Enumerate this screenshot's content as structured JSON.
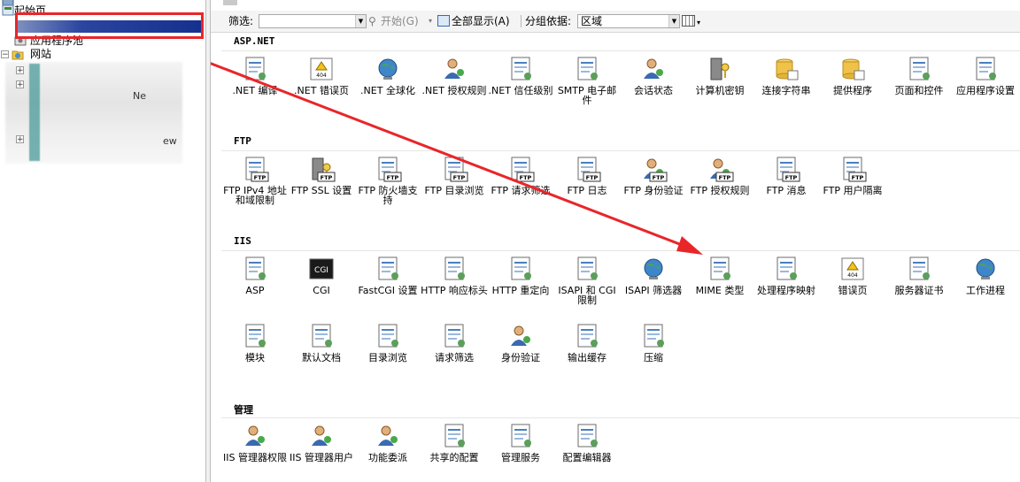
{
  "tree": {
    "items": [
      {
        "label": "起始页"
      },
      {
        "label": "应用程序池"
      },
      {
        "label": "网站"
      },
      {
        "label": "Ne"
      },
      {
        "label": "ew"
      }
    ]
  },
  "toolbar": {
    "filter_label": "筛选:",
    "start_label": "开始(G)",
    "show_all_label": "全部显示(A)",
    "group_label": "分组依据:",
    "group_value": "区域"
  },
  "sections": [
    {
      "title": "ASP.NET",
      "features": [
        {
          "label": ".NET 编译",
          "icon": "net-compile-icon"
        },
        {
          "label": ".NET 错误页",
          "icon": "net-error-page-icon"
        },
        {
          "label": ".NET 全球化",
          "icon": "net-globalization-icon"
        },
        {
          "label": ".NET 授权规则",
          "icon": "net-authorization-icon"
        },
        {
          "label": ".NET 信任级别",
          "icon": "net-trust-icon"
        },
        {
          "label": "SMTP 电子邮件",
          "icon": "smtp-email-icon"
        },
        {
          "label": "会话状态",
          "icon": "session-state-icon"
        },
        {
          "label": "计算机密钥",
          "icon": "machine-key-icon"
        },
        {
          "label": "连接字符串",
          "icon": "connection-strings-icon"
        },
        {
          "label": "提供程序",
          "icon": "providers-icon"
        },
        {
          "label": "页面和控件",
          "icon": "pages-controls-icon"
        },
        {
          "label": "应用程序设置",
          "icon": "app-settings-icon"
        }
      ]
    },
    {
      "title": "FTP",
      "features": [
        {
          "label": "FTP IPv4 地址和域限制",
          "icon": "ftp-ipv4-icon"
        },
        {
          "label": "FTP SSL 设置",
          "icon": "ftp-ssl-icon"
        },
        {
          "label": "FTP 防火墙支持",
          "icon": "ftp-firewall-icon"
        },
        {
          "label": "FTP 目录浏览",
          "icon": "ftp-directory-icon"
        },
        {
          "label": "FTP 请求筛选",
          "icon": "ftp-request-filter-icon"
        },
        {
          "label": "FTP 日志",
          "icon": "ftp-log-icon"
        },
        {
          "label": "FTP 身份验证",
          "icon": "ftp-auth-icon"
        },
        {
          "label": "FTP 授权规则",
          "icon": "ftp-authorization-icon"
        },
        {
          "label": "FTP 消息",
          "icon": "ftp-messages-icon"
        },
        {
          "label": "FTP 用户隔离",
          "icon": "ftp-user-isolation-icon"
        }
      ]
    },
    {
      "title": "IIS",
      "features": [
        {
          "label": "ASP",
          "icon": "asp-icon"
        },
        {
          "label": "CGI",
          "icon": "cgi-icon"
        },
        {
          "label": "FastCGI 设置",
          "icon": "fastcgi-icon"
        },
        {
          "label": "HTTP 响应标头",
          "icon": "http-headers-icon"
        },
        {
          "label": "HTTP 重定向",
          "icon": "http-redirect-icon"
        },
        {
          "label": "ISAPI 和 CGI 限制",
          "icon": "isapi-cgi-icon"
        },
        {
          "label": "ISAPI 筛选器",
          "icon": "isapi-filter-icon"
        },
        {
          "label": "MIME 类型",
          "icon": "mime-types-icon"
        },
        {
          "label": "处理程序映射",
          "icon": "handler-mappings-icon"
        },
        {
          "label": "错误页",
          "icon": "error-pages-icon"
        },
        {
          "label": "服务器证书",
          "icon": "server-certificates-icon"
        },
        {
          "label": "工作进程",
          "icon": "worker-processes-icon"
        },
        {
          "label": "模块",
          "icon": "modules-icon"
        },
        {
          "label": "默认文档",
          "icon": "default-document-icon"
        },
        {
          "label": "目录浏览",
          "icon": "directory-browsing-icon"
        },
        {
          "label": "请求筛选",
          "icon": "request-filtering-icon"
        },
        {
          "label": "身份验证",
          "icon": "authentication-icon"
        },
        {
          "label": "输出缓存",
          "icon": "output-caching-icon"
        },
        {
          "label": "压缩",
          "icon": "compression-icon"
        }
      ]
    },
    {
      "title": "管理",
      "features": [
        {
          "label": "IIS 管理器权限",
          "icon": "iis-manager-permissions-icon"
        },
        {
          "label": "IIS 管理器用户",
          "icon": "iis-manager-users-icon"
        },
        {
          "label": "功能委派",
          "icon": "feature-delegation-icon"
        },
        {
          "label": "共享的配置",
          "icon": "shared-configuration-icon"
        },
        {
          "label": "管理服务",
          "icon": "management-service-icon"
        },
        {
          "label": "配置编辑器",
          "icon": "configuration-editor-icon"
        }
      ]
    }
  ],
  "colors": {
    "annotation": "#e8262a",
    "tree_blue": "#1f3a93"
  }
}
